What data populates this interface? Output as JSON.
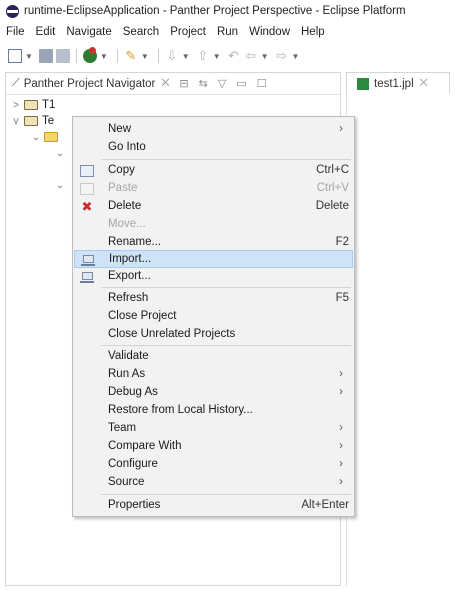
{
  "window": {
    "title": "runtime-EclipseApplication - Panther Project Perspective - Eclipse Platform"
  },
  "menubar": {
    "items": [
      "File",
      "Edit",
      "Navigate",
      "Search",
      "Project",
      "Run",
      "Window",
      "Help"
    ]
  },
  "navigator": {
    "tab_label": "Panther Project Navigator",
    "tab_close": "⨉",
    "tree": [
      {
        "twisty": ">",
        "label": "T1"
      },
      {
        "twisty": "v",
        "label": "Te"
      }
    ]
  },
  "editor": {
    "tab_label": "test1.jpl",
    "tab_close": "⨉"
  },
  "context_menu": {
    "items": [
      {
        "label": "New",
        "submenu": true
      },
      {
        "label": "Go Into"
      },
      {
        "label": "Copy",
        "accelerator": "Ctrl+C",
        "icon": "copy-icon"
      },
      {
        "label": "Paste",
        "accelerator": "Ctrl+V",
        "icon": "paste-icon",
        "disabled": true
      },
      {
        "label": "Delete",
        "accelerator": "Delete",
        "icon": "delete-icon"
      },
      {
        "label": "Move...",
        "disabled": true
      },
      {
        "label": "Rename...",
        "accelerator": "F2"
      },
      {
        "label": "Import...",
        "icon": "import-icon",
        "selected": true
      },
      {
        "label": "Export...",
        "icon": "export-icon"
      },
      {
        "label": "Refresh",
        "accelerator": "F5"
      },
      {
        "label": "Close Project"
      },
      {
        "label": "Close Unrelated Projects"
      },
      {
        "label": "Validate"
      },
      {
        "label": "Run As",
        "submenu": true
      },
      {
        "label": "Debug As",
        "submenu": true
      },
      {
        "label": "Restore from Local History..."
      },
      {
        "label": "Team",
        "submenu": true
      },
      {
        "label": "Compare With",
        "submenu": true
      },
      {
        "label": "Configure",
        "submenu": true
      },
      {
        "label": "Source",
        "submenu": true
      },
      {
        "label": "Properties",
        "accelerator": "Alt+Enter"
      }
    ]
  },
  "colors": {
    "selection_bg": "#cfe3f8",
    "menu_bg": "#f2f2f2",
    "delete_icon": "#c62f2f"
  }
}
